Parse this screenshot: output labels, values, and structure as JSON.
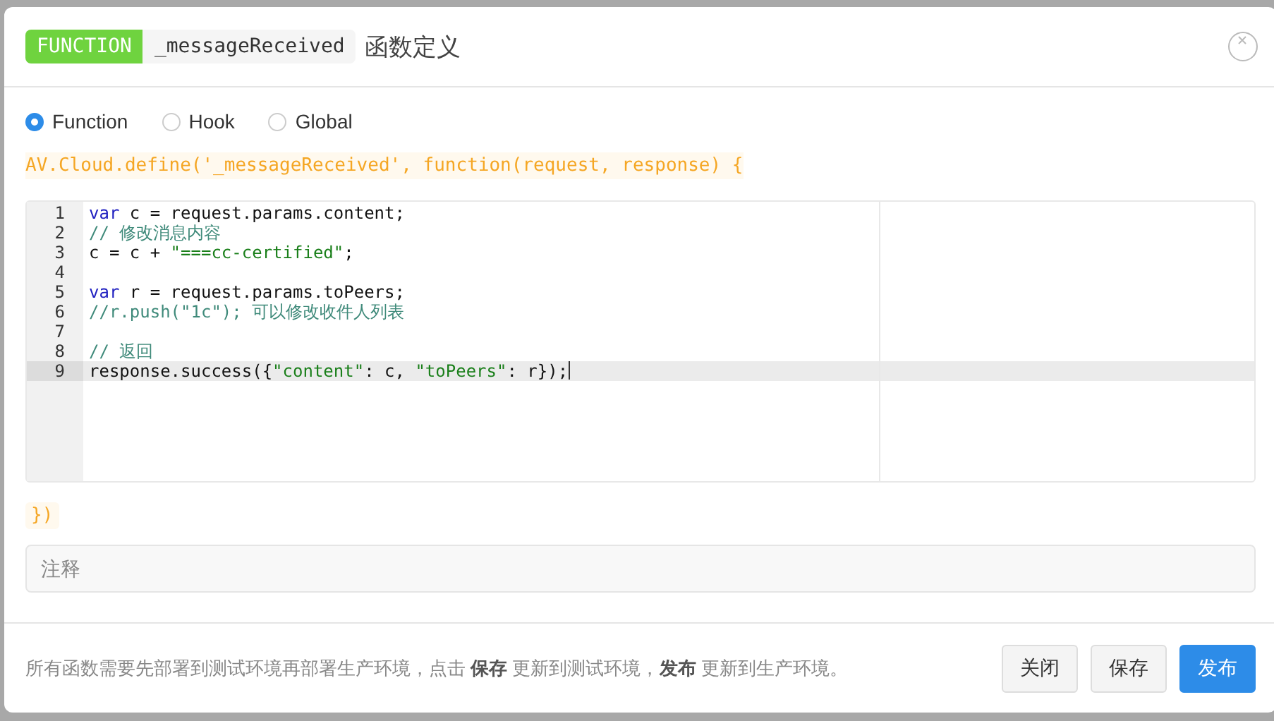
{
  "header": {
    "badge": "FUNCTION",
    "function_name": "_messageReceived",
    "title": "函数定义"
  },
  "radios": [
    {
      "label": "Function",
      "selected": true
    },
    {
      "label": "Hook",
      "selected": false
    },
    {
      "label": "Global",
      "selected": false
    }
  ],
  "code_prefix": "AV.Cloud.define('_messageReceived', function(request, response) {",
  "editor": {
    "lines": [
      {
        "number": "1",
        "active": false,
        "tokens": [
          {
            "kind": "keyword",
            "text": "var"
          },
          {
            "kind": "plain",
            "text": " c = request.params.content;"
          }
        ]
      },
      {
        "number": "2",
        "active": false,
        "tokens": [
          {
            "kind": "comment",
            "text": "// 修改消息内容"
          }
        ]
      },
      {
        "number": "3",
        "active": false,
        "tokens": [
          {
            "kind": "plain",
            "text": "c = c + "
          },
          {
            "kind": "string",
            "text": "\"===cc-certified\""
          },
          {
            "kind": "plain",
            "text": ";"
          }
        ]
      },
      {
        "number": "4",
        "active": false
      },
      {
        "number": "5",
        "active": false,
        "tokens": [
          {
            "kind": "keyword",
            "text": "var"
          },
          {
            "kind": "plain",
            "text": " r = request.params.toPeers;"
          }
        ]
      },
      {
        "number": "6",
        "active": false,
        "tokens": [
          {
            "kind": "comment",
            "text": "//r.push(\"1c\"); 可以修改收件人列表"
          }
        ]
      },
      {
        "number": "7",
        "active": false
      },
      {
        "number": "8",
        "active": false,
        "tokens": [
          {
            "kind": "comment",
            "text": "// 返回"
          }
        ]
      },
      {
        "number": "9",
        "active": true,
        "tokens": [
          {
            "kind": "plain",
            "text": "response.success({"
          },
          {
            "kind": "string",
            "text": "\"content\""
          },
          {
            "kind": "plain",
            "text": ": c, "
          },
          {
            "kind": "string",
            "text": "\"toPeers\""
          },
          {
            "kind": "plain",
            "text": ": r});"
          }
        ]
      }
    ]
  },
  "code_suffix": "})",
  "comment_field": {
    "placeholder": "注释"
  },
  "footer": {
    "note": "所有函数需要先部署到测试环境再部署生产环境，点击 **保存** 更新到测试环境，**发布** 更新到生产环境。",
    "buttons": [
      {
        "label": "关闭",
        "kind": "default"
      },
      {
        "label": "保存",
        "kind": "default"
      },
      {
        "label": "发布",
        "kind": "primary"
      }
    ]
  }
}
